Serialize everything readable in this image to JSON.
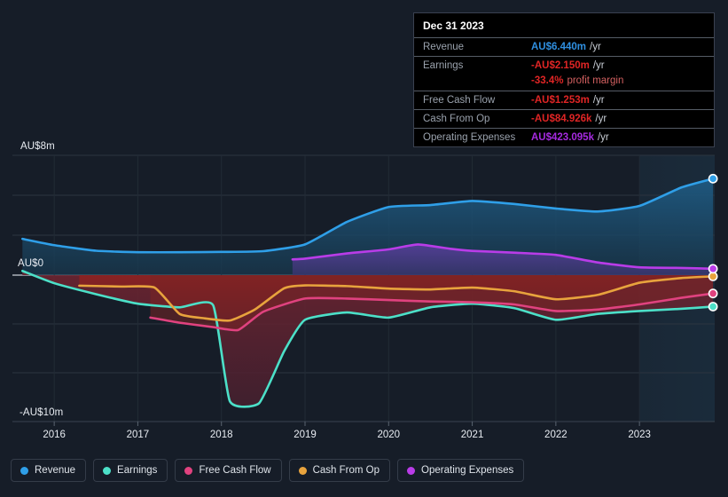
{
  "chart_data": {
    "type": "area",
    "title": "",
    "xlabel": "",
    "ylabel": "",
    "currency": "AU$",
    "x_tick_labels": [
      "2016",
      "2017",
      "2018",
      "2019",
      "2020",
      "2021",
      "2022",
      "2023"
    ],
    "y_tick_labels": [
      "AU$8m",
      "AU$0",
      "-AU$10m"
    ],
    "ylim": [
      -10,
      8
    ],
    "xlim": [
      2015.5,
      2023.9
    ],
    "grid": true,
    "legend_position": "bottom-left",
    "forecast_band_start": "2023",
    "series": [
      {
        "name": "Revenue",
        "color": "#2f9fe8",
        "fill": "#1c4a66",
        "x": [
          2015.62,
          2016.0,
          2016.5,
          2017.0,
          2017.5,
          2018.0,
          2018.5,
          2019.0,
          2019.5,
          2020.0,
          2020.5,
          2021.0,
          2021.5,
          2022.0,
          2022.5,
          2023.0,
          2023.5,
          2023.88
        ],
        "values": [
          2.42,
          2.0,
          1.63,
          1.53,
          1.53,
          1.55,
          1.6,
          2.05,
          3.55,
          4.55,
          4.68,
          4.95,
          4.75,
          4.45,
          4.25,
          4.62,
          5.85,
          6.44
        ]
      },
      {
        "name": "Earnings",
        "color": "#4ce0c8",
        "fill": "#6b2229",
        "x": [
          2015.62,
          2016.0,
          2016.5,
          2017.0,
          2017.5,
          2017.9,
          2018.1,
          2018.45,
          2018.75,
          2019.0,
          2019.5,
          2020.0,
          2020.5,
          2021.0,
          2021.5,
          2022.0,
          2022.5,
          2023.0,
          2023.5,
          2023.88
        ],
        "values": [
          0.28,
          -0.55,
          -1.3,
          -1.95,
          -2.2,
          -2.05,
          -8.6,
          -8.75,
          -5.2,
          -3.05,
          -2.55,
          -2.9,
          -2.2,
          -1.95,
          -2.25,
          -3.05,
          -2.65,
          -2.45,
          -2.3,
          -2.15
        ]
      },
      {
        "name": "Free Cash Flow",
        "color": "#e0427f",
        "fill": "#7a2020",
        "x": [
          2017.15,
          2017.5,
          2017.9,
          2018.2,
          2018.5,
          2019.0,
          2019.5,
          2020.0,
          2020.5,
          2021.0,
          2021.5,
          2022.0,
          2022.5,
          2023.0,
          2023.5,
          2023.88
        ],
        "values": [
          -2.9,
          -3.25,
          -3.55,
          -3.75,
          -2.5,
          -1.6,
          -1.6,
          -1.7,
          -1.8,
          -1.85,
          -2.0,
          -2.45,
          -2.35,
          -2.0,
          -1.55,
          -1.253
        ]
      },
      {
        "name": "Cash From Op",
        "color": "#e8a33d",
        "fill": "#7a2020",
        "x": [
          2016.3,
          2016.8,
          2017.2,
          2017.5,
          2017.8,
          2018.1,
          2018.4,
          2018.75,
          2019.0,
          2019.5,
          2020.0,
          2020.5,
          2021.0,
          2021.5,
          2022.0,
          2022.5,
          2023.0,
          2023.5,
          2023.88
        ],
        "values": [
          -0.72,
          -0.78,
          -0.85,
          -2.65,
          -2.95,
          -3.1,
          -2.35,
          -0.9,
          -0.7,
          -0.75,
          -0.92,
          -0.98,
          -0.85,
          -1.1,
          -1.65,
          -1.35,
          -0.52,
          -0.2,
          -0.085
        ]
      },
      {
        "name": "Operating Expenses",
        "color": "#b93ce8",
        "fill": "#3d2f6e",
        "x": [
          2018.85,
          2019.0,
          2019.5,
          2020.0,
          2020.35,
          2020.75,
          2021.0,
          2021.5,
          2022.0,
          2022.5,
          2023.0,
          2023.5,
          2023.88
        ],
        "values": [
          1.05,
          1.1,
          1.45,
          1.72,
          2.05,
          1.75,
          1.62,
          1.5,
          1.35,
          0.85,
          0.52,
          0.48,
          0.423
        ]
      }
    ]
  },
  "axis": {
    "y_top": "AU$8m",
    "y_zero": "AU$0",
    "y_bottom": "-AU$10m",
    "x_ticks": [
      "2016",
      "2017",
      "2018",
      "2019",
      "2020",
      "2021",
      "2022",
      "2023"
    ]
  },
  "tooltip": {
    "date": "Dec 31 2023",
    "rows": [
      {
        "key": "Revenue",
        "value": "AU$6.440m",
        "suffix": "/yr",
        "color_class": "v-blue"
      },
      {
        "key": "Earnings",
        "value": "-AU$2.150m",
        "suffix": "/yr",
        "color_class": "v-red"
      },
      {
        "key": "",
        "value": "-33.4%",
        "suffix": "profit margin",
        "color_class": "v-red"
      },
      {
        "key": "Free Cash Flow",
        "value": "-AU$1.253m",
        "suffix": "/yr",
        "color_class": "v-red"
      },
      {
        "key": "Cash From Op",
        "value": "-AU$84.926k",
        "suffix": "/yr",
        "color_class": "v-red"
      },
      {
        "key": "Operating Expenses",
        "value": "AU$423.095k",
        "suffix": "/yr",
        "color_class": "v-magenta"
      }
    ]
  },
  "legend": {
    "items": [
      {
        "label": "Revenue",
        "color": "#2f9fe8"
      },
      {
        "label": "Earnings",
        "color": "#4ce0c8"
      },
      {
        "label": "Free Cash Flow",
        "color": "#e0427f"
      },
      {
        "label": "Cash From Op",
        "color": "#e8a33d"
      },
      {
        "label": "Operating Expenses",
        "color": "#b93ce8"
      }
    ]
  }
}
